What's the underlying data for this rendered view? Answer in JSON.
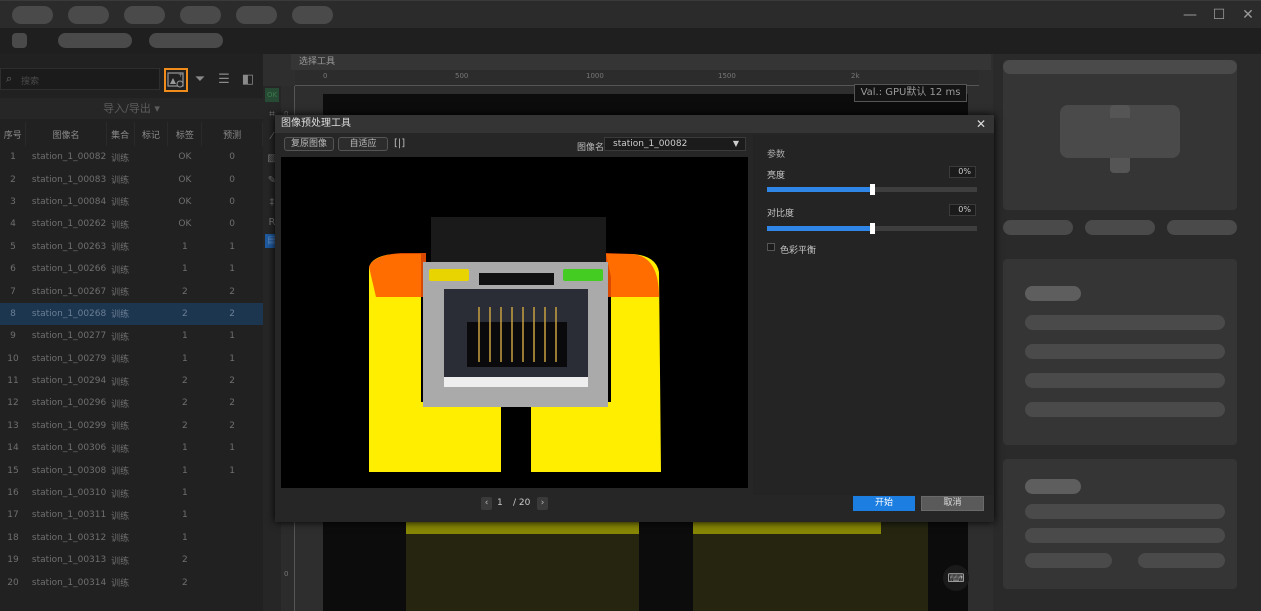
{
  "window": {
    "minimize": "—",
    "maximize": "☐",
    "close": "✕"
  },
  "left_panel": {
    "search_placeholder": "搜索",
    "import_export": "导入/导出 ▾",
    "columns": [
      "序号",
      "图像名",
      "集合",
      "标记",
      "标签",
      "预测"
    ],
    "rows": [
      {
        "idx": "1",
        "name": "station_1_00082",
        "set": "训练",
        "mark": "",
        "label": "OK",
        "pred": "0"
      },
      {
        "idx": "2",
        "name": "station_1_00083",
        "set": "训练",
        "mark": "",
        "label": "OK",
        "pred": "0"
      },
      {
        "idx": "3",
        "name": "station_1_00084",
        "set": "训练",
        "mark": "",
        "label": "OK",
        "pred": "0"
      },
      {
        "idx": "4",
        "name": "station_1_00262",
        "set": "训练",
        "mark": "",
        "label": "OK",
        "pred": "0"
      },
      {
        "idx": "5",
        "name": "station_1_00263",
        "set": "训练",
        "mark": "",
        "label": "1",
        "pred": "1"
      },
      {
        "idx": "6",
        "name": "station_1_00266",
        "set": "训练",
        "mark": "",
        "label": "1",
        "pred": "1"
      },
      {
        "idx": "7",
        "name": "station_1_00267",
        "set": "训练",
        "mark": "",
        "label": "2",
        "pred": "2"
      },
      {
        "idx": "8",
        "name": "station_1_00268",
        "set": "训练",
        "mark": "",
        "label": "2",
        "pred": "2",
        "selected": true
      },
      {
        "idx": "9",
        "name": "station_1_00277",
        "set": "训练",
        "mark": "",
        "label": "1",
        "pred": "1"
      },
      {
        "idx": "10",
        "name": "station_1_00279",
        "set": "训练",
        "mark": "",
        "label": "1",
        "pred": "1"
      },
      {
        "idx": "11",
        "name": "station_1_00294",
        "set": "训练",
        "mark": "",
        "label": "2",
        "pred": "2"
      },
      {
        "idx": "12",
        "name": "station_1_00296",
        "set": "训练",
        "mark": "",
        "label": "2",
        "pred": "2"
      },
      {
        "idx": "13",
        "name": "station_1_00299",
        "set": "训练",
        "mark": "",
        "label": "2",
        "pred": "2"
      },
      {
        "idx": "14",
        "name": "station_1_00306",
        "set": "训练",
        "mark": "",
        "label": "1",
        "pred": "1"
      },
      {
        "idx": "15",
        "name": "station_1_00308",
        "set": "训练",
        "mark": "",
        "label": "1",
        "pred": "1"
      },
      {
        "idx": "16",
        "name": "station_1_00310",
        "set": "训练",
        "mark": "",
        "label": "1",
        "pred": ""
      },
      {
        "idx": "17",
        "name": "station_1_00311",
        "set": "训练",
        "mark": "",
        "label": "1",
        "pred": ""
      },
      {
        "idx": "18",
        "name": "station_1_00312",
        "set": "训练",
        "mark": "",
        "label": "1",
        "pred": ""
      },
      {
        "idx": "19",
        "name": "station_1_00313",
        "set": "训练",
        "mark": "",
        "label": "2",
        "pred": ""
      },
      {
        "idx": "20",
        "name": "station_1_00314",
        "set": "训练",
        "mark": "",
        "label": "2",
        "pred": ""
      }
    ]
  },
  "canvas": {
    "tab_label": "选择工具",
    "ruler_ticks": [
      "0",
      "500",
      "1000",
      "1500",
      "2k"
    ],
    "vruler_ticks": [
      "0",
      "0"
    ],
    "ok_badge": "OK",
    "val_readout": "Val.: GPU默认 12 ms"
  },
  "dialog": {
    "title": "图像预处理工具",
    "close": "✕",
    "restore_button": "复原图像",
    "fit_button": "自适应",
    "image_name_label": "图像名",
    "image_name_value": "station_1_00082",
    "params_title": "参数",
    "brightness_label": "亮度",
    "brightness_value": "0%",
    "brightness_fraction": 0.5,
    "contrast_label": "对比度",
    "contrast_value": "0%",
    "contrast_fraction": 0.5,
    "color_balance_label": "色彩平衡",
    "color_balance_checked": false,
    "page_current": "1",
    "page_total": "/ 20",
    "start_button": "开始",
    "cancel_button": "取消"
  },
  "colors": {
    "accent": "#2f86e6",
    "highlight": "#f08c1a",
    "selected_row": "#1d3650"
  }
}
